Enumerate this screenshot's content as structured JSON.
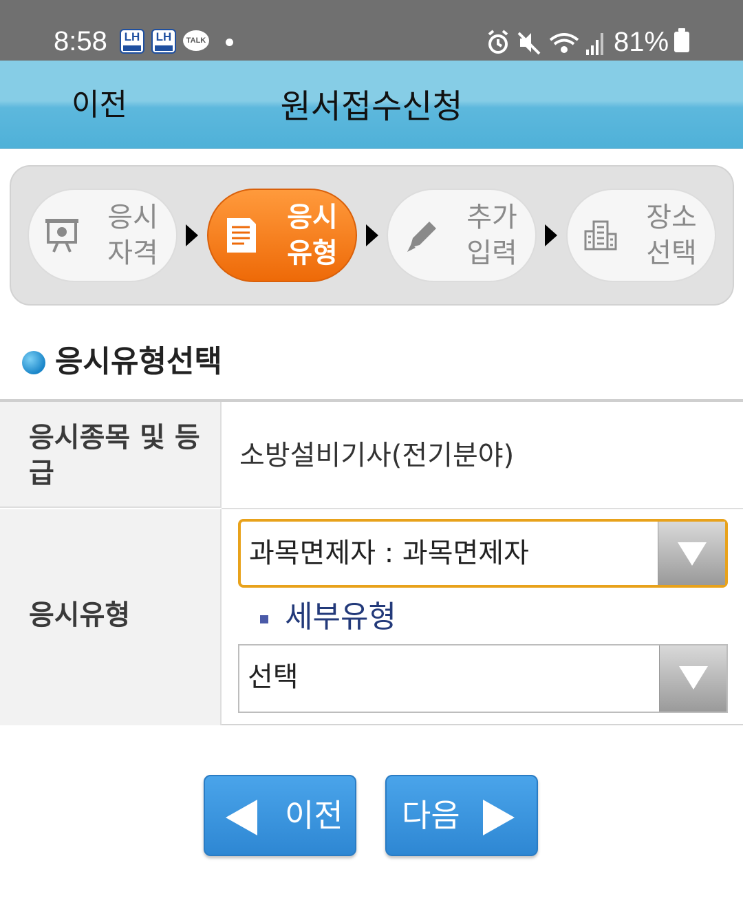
{
  "status_bar": {
    "time": "8:58",
    "notification_icons": [
      "lh-app-icon",
      "lh-app-icon",
      "kakaotalk-icon",
      "dot-icon"
    ],
    "lh_badge_text": "LH",
    "talk_text": "TALK",
    "system_icons": [
      "alarm-icon",
      "mute-icon",
      "wifi-icon",
      "signal-icon"
    ],
    "battery": "81%"
  },
  "header": {
    "back_label": "이전",
    "title": "원서접수신청"
  },
  "steps": [
    {
      "label_line1": "응시",
      "label_line2": "자격",
      "icon": "certificate-icon",
      "active": false
    },
    {
      "label_line1": "응시",
      "label_line2": "유형",
      "icon": "document-icon",
      "active": true
    },
    {
      "label_line1": "추가",
      "label_line2": "입력",
      "icon": "pencil-icon",
      "active": false
    },
    {
      "label_line1": "장소",
      "label_line2": "선택",
      "icon": "building-icon",
      "active": false
    }
  ],
  "section": {
    "title": "응시유형선택"
  },
  "form": {
    "row1_label_line1": "응시종목 및 등",
    "row1_label_line2": "급",
    "row1_value": "소방설비기사(전기분야)",
    "row2_label": "응시유형",
    "exam_type_select_value": "과목면제자 : 과목면제자",
    "sub_type_label": "세부유형",
    "sub_type_select_value": "선택"
  },
  "buttons": {
    "prev_label": "이전",
    "next_label": "다음"
  },
  "colors": {
    "header_blue": "#5db8dd",
    "active_step_orange": "#ee6a08",
    "button_blue": "#3592dc",
    "focus_border": "#e8a21b"
  }
}
